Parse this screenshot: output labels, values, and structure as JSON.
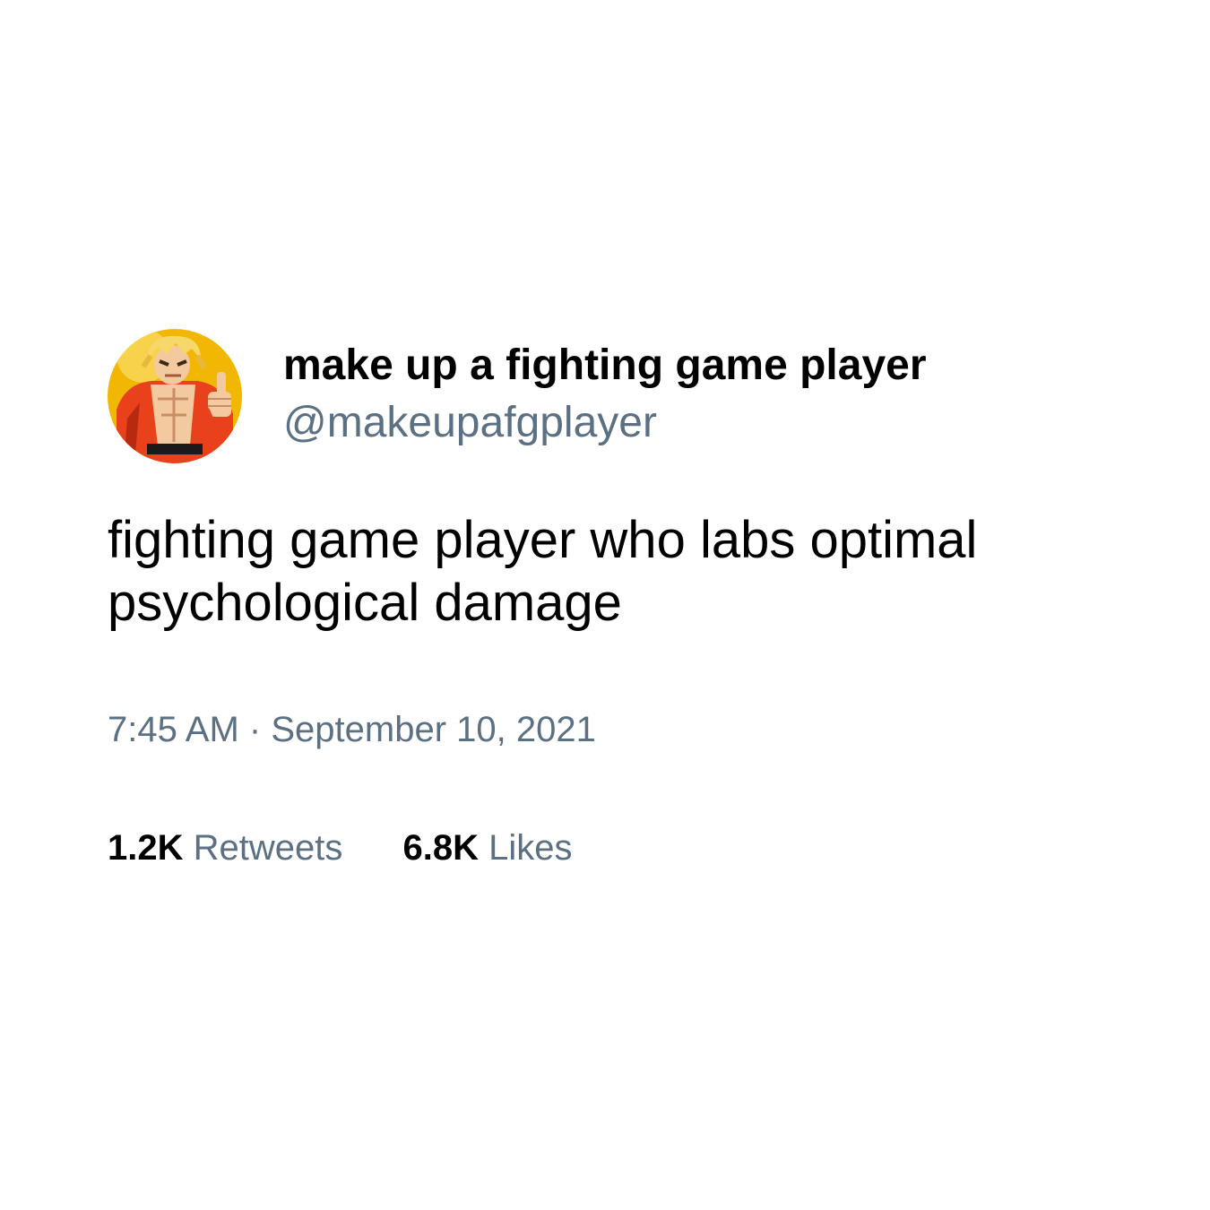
{
  "tweet": {
    "display_name": "make up a fighting game player",
    "handle": "@makeupafgplayer",
    "text": "fighting game player who labs optimal psychological damage",
    "time": "7:45 AM",
    "separator": "·",
    "date": "September 10, 2021",
    "retweets_count": "1.2K",
    "retweets_label": "Retweets",
    "likes_count": "6.8K",
    "likes_label": "Likes"
  },
  "avatar": {
    "icon": "pixel-art-fighter-thumbs-up-avatar",
    "background_color": "#f2b705",
    "gi_color": "#e8411c"
  },
  "colors": {
    "text_primary": "#000000",
    "text_secondary": "#5b7083",
    "background": "#ffffff"
  }
}
